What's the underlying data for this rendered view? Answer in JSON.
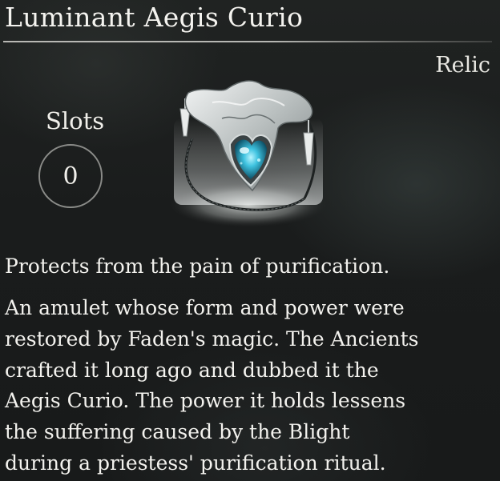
{
  "item": {
    "name": "Luminant Aegis Curio",
    "category": "Relic",
    "slots_label": "Slots",
    "slots_value": "0",
    "icon": "amulet-icon",
    "short_description": "Protects from the pain of purification.",
    "long_description_lines": [
      "An amulet whose form and power were",
      "restored by Faden's magic. The Ancients",
      "crafted it long ago and dubbed it the",
      "Aegis Curio. The power it holds lessens",
      "the suffering caused by the Blight",
      "during a priestess' purification ritual."
    ]
  },
  "colors": {
    "background": "#1c1e1e",
    "text": "#f1f1ee",
    "gem": "#3fc3e0",
    "silver": "#d9dcdc"
  }
}
